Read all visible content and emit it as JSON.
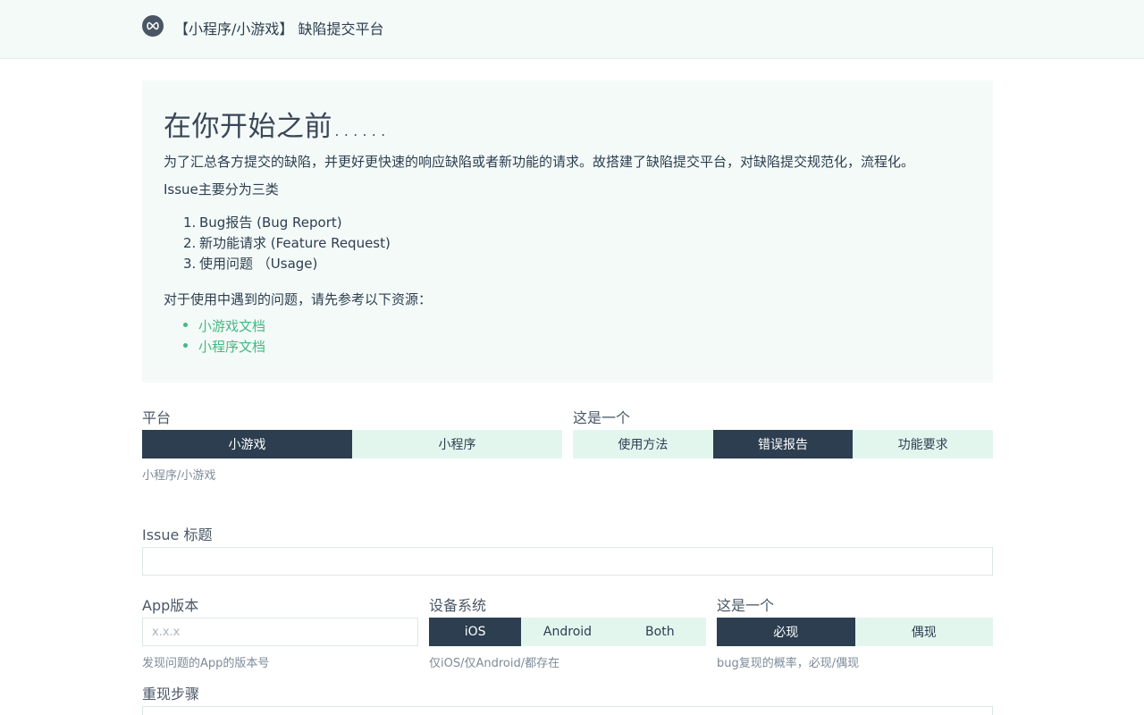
{
  "header": {
    "title": "【小程序/小游戏】 缺陷提交平台"
  },
  "intro": {
    "heading": "在你开始之前......",
    "paragraph": "为了汇总各方提交的缺陷，并更好更快速的响应缺陷或者新功能的请求。故搭建了缺陷提交平台，对缺陷提交规范化，流程化。",
    "issue_types_intro": "Issue主要分为三类",
    "issue_types": [
      {
        "num": "1.",
        "label": "Bug报告 (Bug Report)"
      },
      {
        "num": "2.",
        "label": "新功能请求 (Feature Request)"
      },
      {
        "num": "3.",
        "label": "使用问题 （Usage)"
      }
    ],
    "resources_intro": "对于使用中遇到的问题，请先参考以下资源：",
    "resources": [
      "小游戏文档",
      "小程序文档"
    ]
  },
  "form": {
    "platform": {
      "label": "平台",
      "options": [
        "小游戏",
        "小程序"
      ],
      "selected": "小游戏",
      "hint": "小程序/小游戏"
    },
    "issue_type": {
      "label": "这是一个",
      "options": [
        "使用方法",
        "错误报告",
        "功能要求"
      ],
      "selected": "错误报告"
    },
    "title": {
      "label": "Issue 标题",
      "value": "",
      "placeholder": ""
    },
    "app_version": {
      "label": "App版本",
      "value": "",
      "placeholder": "x.x.x",
      "hint": "发现问题的App的版本号"
    },
    "os": {
      "label": "设备系统",
      "options": [
        "iOS",
        "Android",
        "Both"
      ],
      "selected": "iOS",
      "hint": "仅iOS/仅Android/都存在"
    },
    "reproducibility": {
      "label": "这是一个",
      "options": [
        "必现",
        "偶现"
      ],
      "selected": "必现",
      "hint": "bug复现的概率，必现/偶现"
    },
    "steps": {
      "label": "重现步骤"
    }
  },
  "colors": {
    "accent": "#42b983",
    "dark": "#2c3e50",
    "light_bg": "#f4faf8",
    "option_bg": "#e3f6ee"
  },
  "icons": {
    "logo": "infinity-logo-icon"
  }
}
